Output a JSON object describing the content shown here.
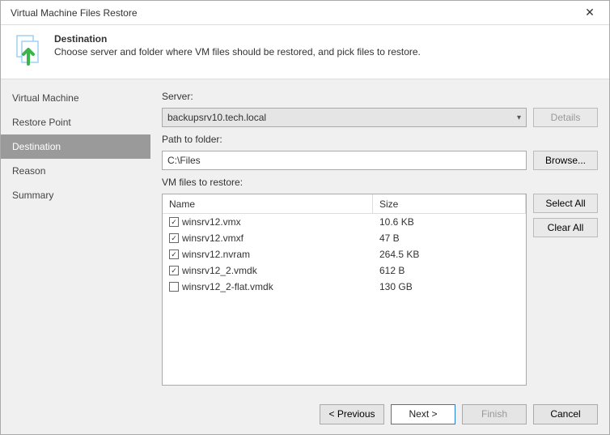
{
  "window": {
    "title": "Virtual Machine Files Restore",
    "close": "✕"
  },
  "header": {
    "title": "Destination",
    "subtitle": "Choose server and folder where VM files should be restored, and pick files to restore."
  },
  "sidebar": {
    "items": [
      {
        "label": "Virtual Machine"
      },
      {
        "label": "Restore Point"
      },
      {
        "label": "Destination"
      },
      {
        "label": "Reason"
      },
      {
        "label": "Summary"
      }
    ]
  },
  "form": {
    "server_label": "Server:",
    "server_value": "backupsrv10.tech.local",
    "details_btn": "Details",
    "path_label": "Path to folder:",
    "path_value": "C:\\Files",
    "browse_btn": "Browse...",
    "files_label": "VM files to restore:",
    "cols": {
      "name": "Name",
      "size": "Size"
    },
    "files": [
      {
        "name": "winsrv12.vmx",
        "size": "10.6 KB",
        "checked": true
      },
      {
        "name": "winsrv12.vmxf",
        "size": "47 B",
        "checked": true
      },
      {
        "name": "winsrv12.nvram",
        "size": "264.5 KB",
        "checked": true
      },
      {
        "name": "winsrv12_2.vmdk",
        "size": "612 B",
        "checked": true
      },
      {
        "name": "winsrv12_2-flat.vmdk",
        "size": "130 GB",
        "checked": false
      }
    ],
    "select_all": "Select All",
    "clear_all": "Clear All"
  },
  "footer": {
    "previous": "< Previous",
    "next": "Next >",
    "finish": "Finish",
    "cancel": "Cancel"
  }
}
